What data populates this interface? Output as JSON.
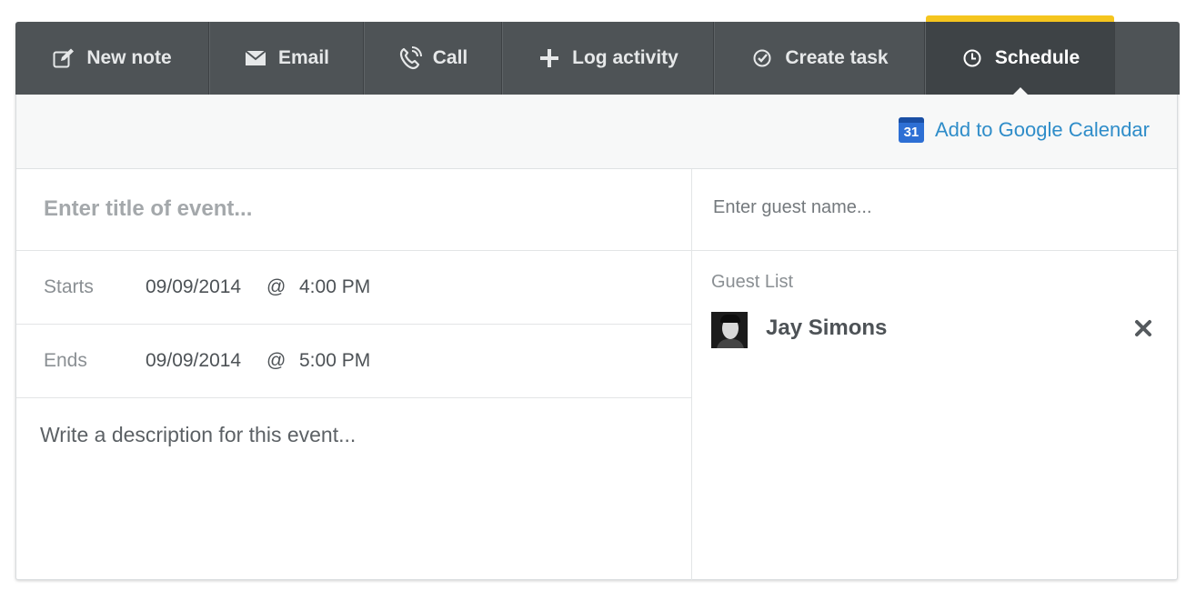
{
  "tabs": [
    {
      "label": "New note",
      "icon": "edit-icon"
    },
    {
      "label": "Email",
      "icon": "envelope-icon"
    },
    {
      "label": "Call",
      "icon": "phone-icon"
    },
    {
      "label": "Log activity",
      "icon": "plus-icon"
    },
    {
      "label": "Create task",
      "icon": "check-circle-icon"
    },
    {
      "label": "Schedule",
      "icon": "clock-icon",
      "active": true
    }
  ],
  "calendar_link": {
    "label": "Add to Google Calendar",
    "icon_text": "31",
    "color": "#2f8dc9"
  },
  "event": {
    "title_placeholder": "Enter title of event...",
    "starts_label": "Starts",
    "starts_date": "09/09/2014",
    "starts_at": "@",
    "starts_time": "4:00 PM",
    "ends_label": "Ends",
    "ends_date": "09/09/2014",
    "ends_at": "@",
    "ends_time": "5:00 PM",
    "description_placeholder": "Write a description for this event..."
  },
  "guests": {
    "input_placeholder": "Enter guest name...",
    "list_label": "Guest List",
    "items": [
      {
        "name": "Jay Simons"
      }
    ]
  },
  "colors": {
    "tab_bar": "#4e5356",
    "active_accent": "#f5c51e",
    "link": "#2f8dc9"
  }
}
